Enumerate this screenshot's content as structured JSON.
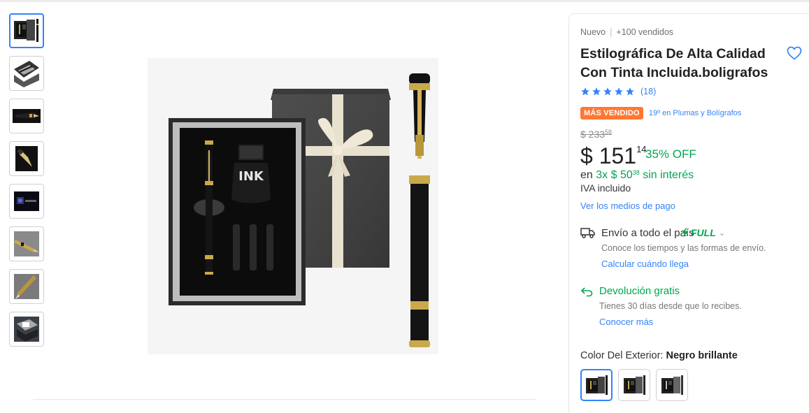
{
  "thumbnails": [
    {
      "icon": "pen-gift-set-thumbnail"
    },
    {
      "icon": "pen-box-open-thumbnail"
    },
    {
      "icon": "pen-nib-thumbnail"
    },
    {
      "icon": "pen-nib-closeup-thumbnail"
    },
    {
      "icon": "pen-dark-scene-thumbnail"
    },
    {
      "icon": "pen-gold-thumbnail"
    },
    {
      "icon": "pen-gold-angle-thumbnail"
    },
    {
      "icon": "pen-gift-box-thumbnail"
    }
  ],
  "main_image": {
    "icon": "fountain-pen-gift-set-image",
    "ink_label": "INK"
  },
  "product": {
    "condition": "Nuevo",
    "sold": "+100 vendidos",
    "title": "Estilográfica De Alta Calidad Con Tinta Incluida.boligrafos",
    "rating_stars": 5,
    "reviews": "(18)",
    "badge": "MÁS VENDIDO",
    "rank": "19º en Plumas y Bolígrafos",
    "old_price_main": "$ 233",
    "old_price_cents": "58",
    "price_main": "$ 151",
    "price_cents": "14",
    "discount": "35% OFF",
    "installments_prefix": "en",
    "installments_count": "3x",
    "installments_amount": "$ 50",
    "installments_cents": "38",
    "installments_suffix": "sin interés",
    "iva": "IVA incluido",
    "payment_link": "Ver los medios de pago"
  },
  "shipping": {
    "title": "Envío a todo el país",
    "full_label": "FULL",
    "description": "Conoce los tiempos y las formas de envío.",
    "link": "Calcular cuándo llega"
  },
  "returns": {
    "title": "Devolución gratis",
    "description": "Tienes 30 días desde que lo recibes.",
    "link": "Conocer más"
  },
  "color": {
    "label": "Color Del Exterior:",
    "selected": "Negro brillante",
    "options": 3
  },
  "colors": {
    "accent": "#3483fa",
    "success": "#00a650",
    "badge": "#ff7733"
  }
}
